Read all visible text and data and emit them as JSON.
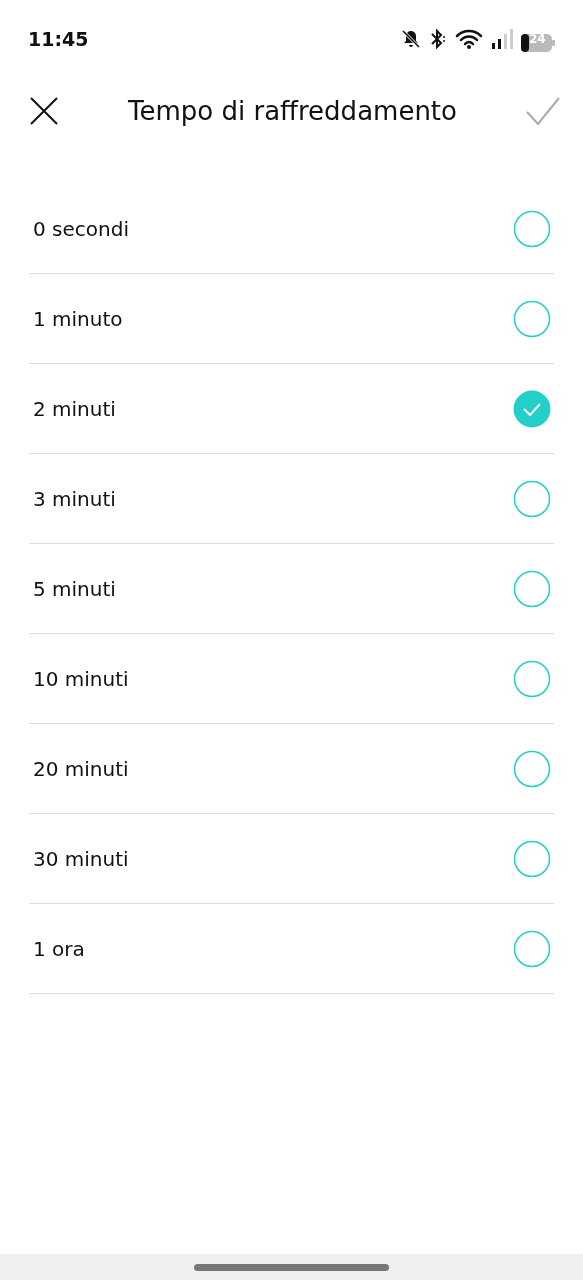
{
  "status_bar": {
    "time": "11:45",
    "battery": "24"
  },
  "header": {
    "title": "Tempo di raffreddamento"
  },
  "options": [
    {
      "label": "0 secondi",
      "selected": false
    },
    {
      "label": "1 minuto",
      "selected": false
    },
    {
      "label": "2 minuti",
      "selected": true
    },
    {
      "label": "3 minuti",
      "selected": false
    },
    {
      "label": "5 minuti",
      "selected": false
    },
    {
      "label": "10 minuti",
      "selected": false
    },
    {
      "label": "20 minuti",
      "selected": false
    },
    {
      "label": "30 minuti",
      "selected": false
    },
    {
      "label": "1 ora",
      "selected": false
    }
  ]
}
